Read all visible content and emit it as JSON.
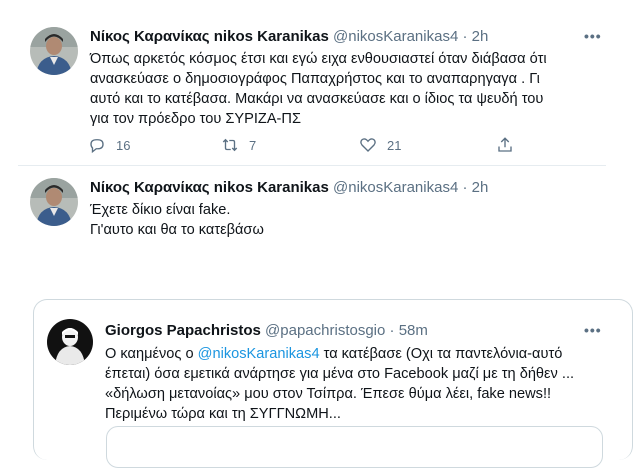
{
  "tweet1": {
    "name": "Νίκος Καρανίκας nikos Karanikas",
    "handle": "@nikosKaranikas4",
    "time": "2h",
    "more": "•••",
    "lines": [
      "Όπως αρκετός κόσμος έτσι και εγώ  ειχα ενθουσιαστεί  όταν διάβασα ότι",
      "ανασκεύασε ο δημοσιογράφος Παπαχρήστος και το αναπαρηγαγα . Γι",
      "αυτό και το κατέβασα. Μακάρι να ανασκεύασε και ο ίδιος τα ψευδή του",
      "για τον πρόεδρο του ΣΥΡΙΖΑ-ΠΣ"
    ],
    "replies": "16",
    "retweets": "7",
    "likes": "21",
    "icons": [
      "reply-icon",
      "retweet-icon",
      "like-icon",
      "share-icon"
    ]
  },
  "tweet2": {
    "name": "Νίκος Καρανίκας nikos Karanikas",
    "handle": "@nikosKaranikas4",
    "time": "2h",
    "lines": [
      "Έχετε δίκιο είναι fake.",
      "Γι'αυτο και θα το κατεβάσω"
    ]
  },
  "quoted": {
    "name": "Giorgos Papachristos",
    "handle": "@papachristosgio",
    "time": "58m",
    "more": "•••",
    "line1_pre": "Ο καημένος ο ",
    "line1_mention": "@nikosKaranikas4",
    "line1_post": " τα κατέβασε (Οχι τα παντελόνια-αυτό",
    "lines": [
      "έπεται) όσα εμετικά ανάρτησε για μένα στο Facebook μαζί με τη δήθεν ...",
      "«δήλωση μετανοίας» μου στον Τσίπρα. Έπεσε θύμα λέει, fake news!!",
      "Περιμένω τώρα και τη ΣΥΓΓΝΩΜΗ..."
    ]
  }
}
